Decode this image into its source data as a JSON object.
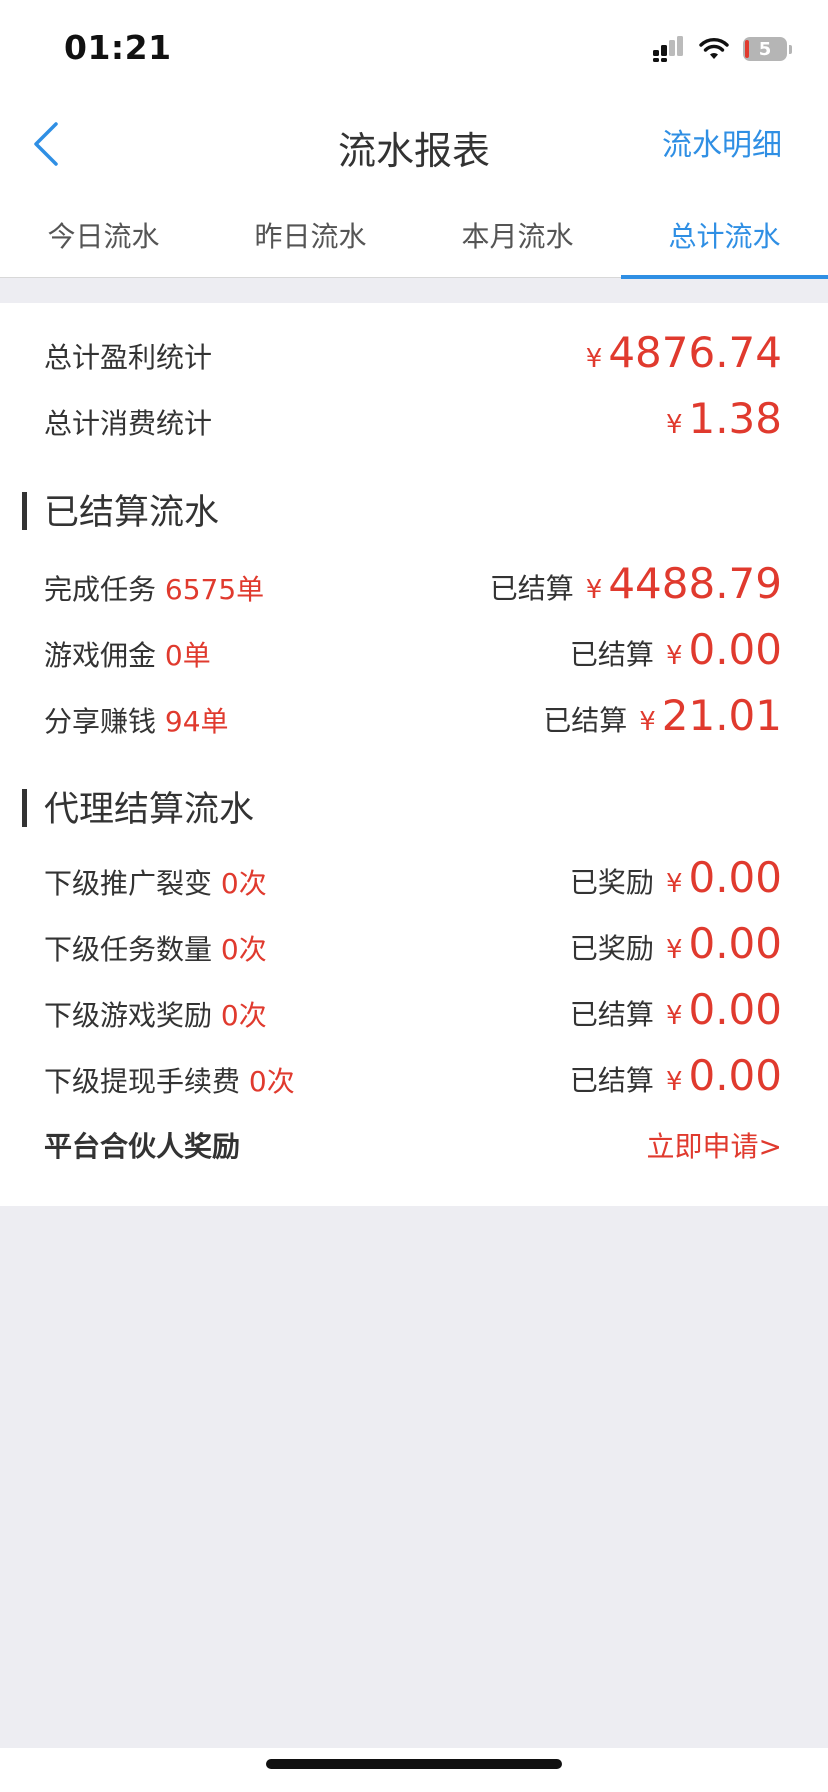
{
  "status": {
    "time": "01:21",
    "battery": "5"
  },
  "nav": {
    "title": "流水报表",
    "right_link": "流水明细"
  },
  "tabs": [
    "今日流水",
    "昨日流水",
    "本月流水",
    "总计流水"
  ],
  "active_tab": 3,
  "totals": {
    "profit_label": "总计盈利统计",
    "profit_currency": "¥",
    "profit_value": "4876.74",
    "consume_label": "总计消费统计",
    "consume_currency": "¥",
    "consume_value": "1.38"
  },
  "settled_section": {
    "title": "已结算流水",
    "rows": [
      {
        "label": "完成任务",
        "count": "6575单",
        "status": "已结算",
        "currency": "¥",
        "amount": "4488.79"
      },
      {
        "label": "游戏佣金",
        "count": "0单",
        "status": "已结算",
        "currency": "¥",
        "amount": "0.00"
      },
      {
        "label": "分享赚钱",
        "count": "94单",
        "status": "已结算",
        "currency": "¥",
        "amount": "21.01"
      }
    ]
  },
  "agent_section": {
    "title": "代理结算流水",
    "rows": [
      {
        "label": "下级推广裂变",
        "count": "0次",
        "status": "已奖励",
        "currency": "¥",
        "amount": "0.00"
      },
      {
        "label": "下级任务数量",
        "count": "0次",
        "status": "已奖励",
        "currency": "¥",
        "amount": "0.00"
      },
      {
        "label": "下级游戏奖励",
        "count": "0次",
        "status": "已结算",
        "currency": "¥",
        "amount": "0.00"
      },
      {
        "label": "下级提现手续费",
        "count": "0次",
        "status": "已结算",
        "currency": "¥",
        "amount": "0.00"
      }
    ],
    "partner_label": "平台合伙人奖励",
    "partner_action": "立即申请>"
  },
  "colors": {
    "accent": "#2f8fe4",
    "amount_red": "#e03a2e"
  }
}
